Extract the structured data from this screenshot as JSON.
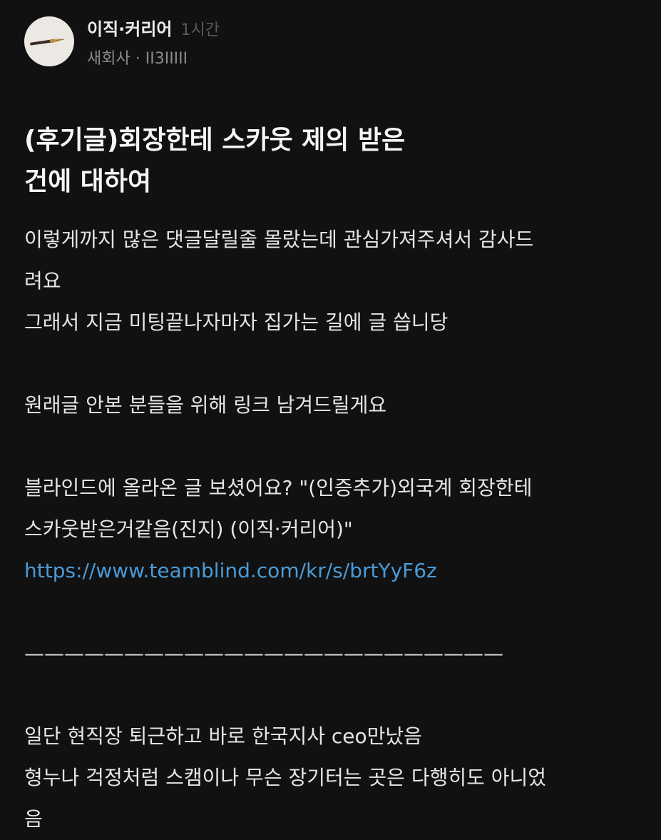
{
  "post": {
    "board_name": "이직·커리어",
    "time_ago": "1시간",
    "author_company": "새회사",
    "separator": "·",
    "author_handle": "II3IIIII",
    "title_line1": "(후기글)회장한테 스카웃 제의 받은",
    "title_line2": "건에 대하여",
    "body": {
      "p1_l1": "이렇게까지 많은 댓글달릴줄 몰랐는데 관심가져주셔서 감사드",
      "p1_l2": "려요",
      "p1_l3": "그래서 지금 미팅끝나자마자 집가는 길에 글 씁니당",
      "p2_l1": "원래글 안본 분들을 위해 링크 남겨드릴게요",
      "p3_l1": "블라인드에 올라온 글 보셨어요? \"(인증추가)외국계 회장한테",
      "p3_l2": "스카웃받은거같음(진지) (이직·커리어)\"",
      "link": "https://www.teamblind.com/kr/s/brtYyF6z",
      "divider": "————————————————————————",
      "p4_l1": "일단 현직장 퇴근하고 바로 한국지사 ceo만났음",
      "p4_l2": "형누나 걱정처럼 스캠이나 무슨 장기터는 곳은 다행히도 아니었",
      "p4_l3": "음"
    }
  },
  "colors": {
    "background": "#111111",
    "link": "#4a9bd8",
    "muted": "#8a8a8a"
  },
  "icons": {
    "avatar": "fountain-pen-icon"
  }
}
